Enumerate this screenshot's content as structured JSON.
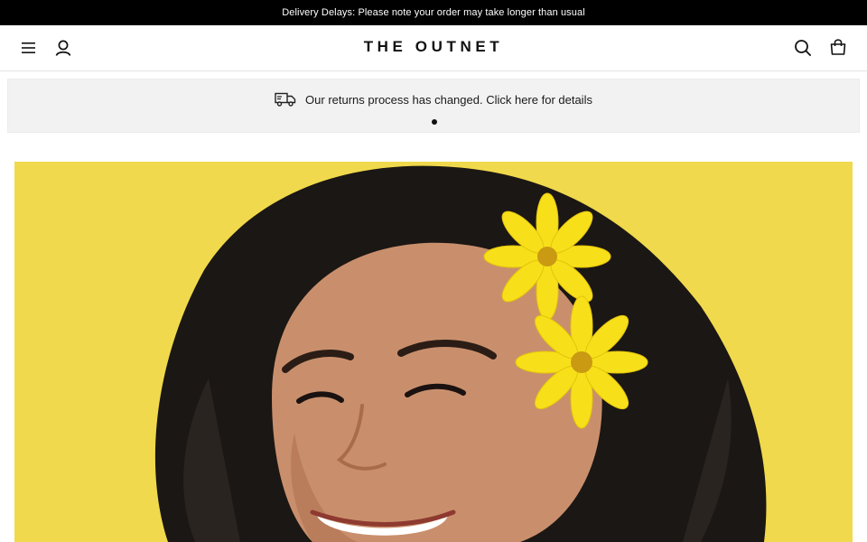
{
  "top_banner": {
    "text": "Delivery Delays: Please note your order may take longer than usual"
  },
  "header": {
    "logo": "THE OUTNET",
    "icons": {
      "menu": "menu-icon",
      "account": "user-icon",
      "search": "search-icon",
      "bag": "shopping-bag-icon"
    }
  },
  "notice": {
    "text": "Our returns process has changed. Click here for details",
    "icon": "truck-icon",
    "carousel_active_index": 1,
    "carousel_count": 1
  },
  "hero": {
    "description_icon": "hero-photo",
    "background_color": "#f0d94c"
  },
  "colors": {
    "banner_bg": "#000000",
    "notice_bg": "#f2f2f2",
    "hero_yellow": "#f0d94c",
    "flower_yellow": "#f7e01a"
  }
}
